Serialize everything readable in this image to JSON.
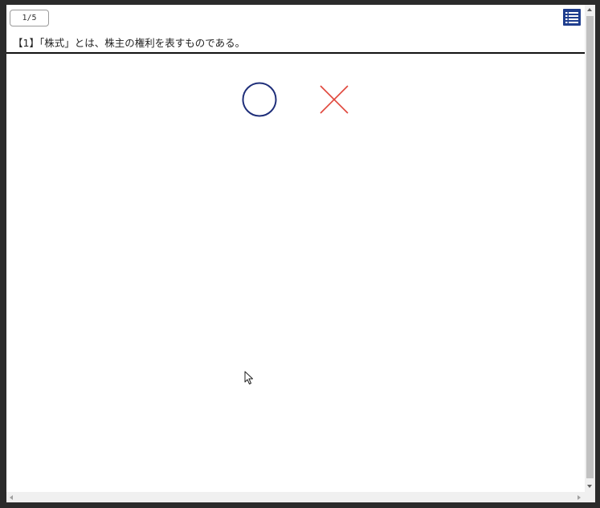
{
  "quiz": {
    "page_counter": "1/5",
    "question_text": "【1】「株式」とは、株主の権利を表すものである。",
    "answers": [
      {
        "id": "true",
        "icon": "circle-icon",
        "color": "#1f2f7a"
      },
      {
        "id": "false",
        "icon": "cross-icon",
        "color": "#e0453a"
      }
    ],
    "menu_icon": "list-icon",
    "accent_color": "#1f3e8e"
  }
}
